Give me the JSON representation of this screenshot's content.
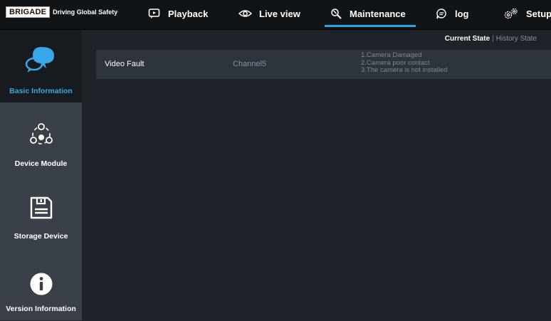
{
  "brand": {
    "logo": "BRIGADE",
    "tagline": "Driving Global Safety"
  },
  "nav": {
    "items": [
      {
        "label": "Playback",
        "icon": "playback-icon"
      },
      {
        "label": "Live view",
        "icon": "eye-icon"
      },
      {
        "label": "Maintenance",
        "icon": "maintenance-icon",
        "active": true
      },
      {
        "label": "log",
        "icon": "log-icon"
      },
      {
        "label": "Setup",
        "icon": "gears-icon"
      }
    ]
  },
  "sidebar": {
    "items": [
      {
        "label": "Basic Information",
        "icon": "chat-bubbles-icon",
        "active": true
      },
      {
        "label": "Device Module",
        "icon": "module-icon"
      },
      {
        "label": "Storage Device",
        "icon": "floppy-disk-icon"
      },
      {
        "label": "Version Information",
        "icon": "info-icon"
      }
    ]
  },
  "state_tabs": {
    "current": "Current State",
    "separator": "|",
    "history": "History State"
  },
  "faults": [
    {
      "type": "Video Fault",
      "channel": "Channel5",
      "reasons": [
        "1.Camera Damaged",
        "2.Camera poor contact",
        "3.The camera is not installed"
      ]
    }
  ],
  "colors": {
    "accent": "#2aa3e8",
    "topbar": "#111417",
    "sidebar": "#3a4048",
    "content": "#1d2329"
  }
}
